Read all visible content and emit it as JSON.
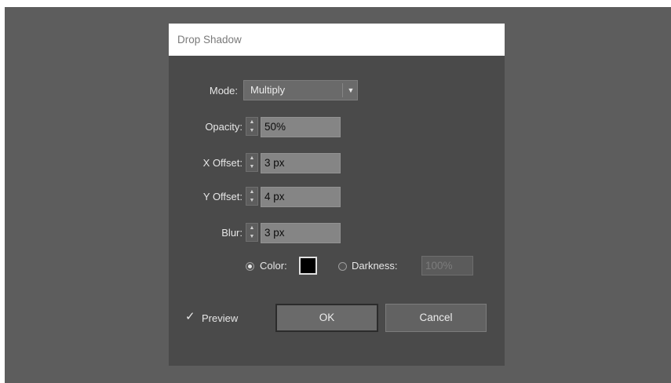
{
  "dialog": {
    "title": "Drop Shadow"
  },
  "mode": {
    "label": "Mode:",
    "value": "Multiply"
  },
  "opacity": {
    "label": "Opacity:",
    "value": "50%"
  },
  "x_offset": {
    "label": "X Offset:",
    "value": "3 px"
  },
  "y_offset": {
    "label": "Y Offset:",
    "value": "4 px"
  },
  "blur": {
    "label": "Blur:",
    "value": "3 px"
  },
  "shadow_source": {
    "color_label": "Color:",
    "color_selected": true,
    "color_value": "#000000",
    "darkness_label": "Darkness:",
    "darkness_value": "100%"
  },
  "preview": {
    "label": "Preview",
    "checked": true
  },
  "buttons": {
    "ok": "OK",
    "cancel": "Cancel"
  },
  "colors": {
    "backdrop": "#5d5d5d",
    "dialog_bg": "#4a4a4a",
    "field_bg": "#858585"
  },
  "icons": {
    "dropdown": "chevron-down-icon",
    "stepper": "stepper-arrows-icon",
    "check": "checkmark-icon"
  }
}
